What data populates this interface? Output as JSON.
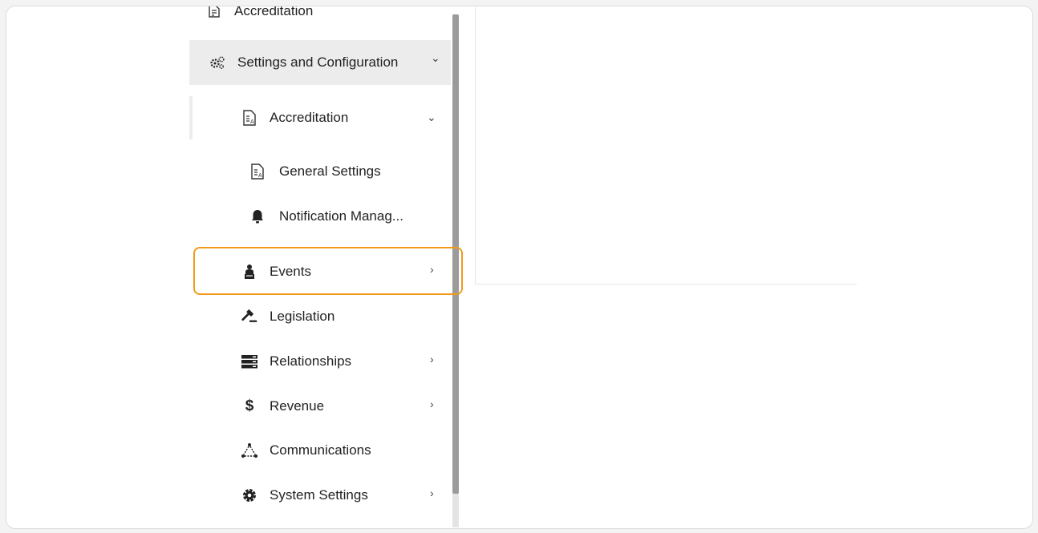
{
  "sidebar": {
    "top_partial": {
      "label": "Accreditation",
      "icon": "document-icon"
    },
    "settings": {
      "label": "Settings and Configuration",
      "icon": "gears-icon",
      "chevron": "⌄"
    },
    "accreditation": {
      "label": "Accreditation",
      "icon": "document-icon",
      "chevron": "⌄"
    },
    "sub_items": [
      {
        "label": "General Settings",
        "icon": "document-icon"
      },
      {
        "label": "Notification Manag...",
        "icon": "bell-icon"
      }
    ],
    "items": [
      {
        "label": "Events",
        "icon": "presenter-icon",
        "chevron": "›"
      },
      {
        "label": "Legislation",
        "icon": "gavel-icon",
        "chevron": ""
      },
      {
        "label": "Relationships",
        "icon": "server-icon",
        "chevron": "›"
      },
      {
        "label": "Revenue",
        "icon": "dollar-icon",
        "chevron": "›"
      },
      {
        "label": "Communications",
        "icon": "network-icon",
        "chevron": ""
      },
      {
        "label": "System Settings",
        "icon": "gear-icon",
        "chevron": "›"
      }
    ]
  },
  "colors": {
    "highlight": "#f29a1a",
    "selected_bg": "#ececec"
  }
}
